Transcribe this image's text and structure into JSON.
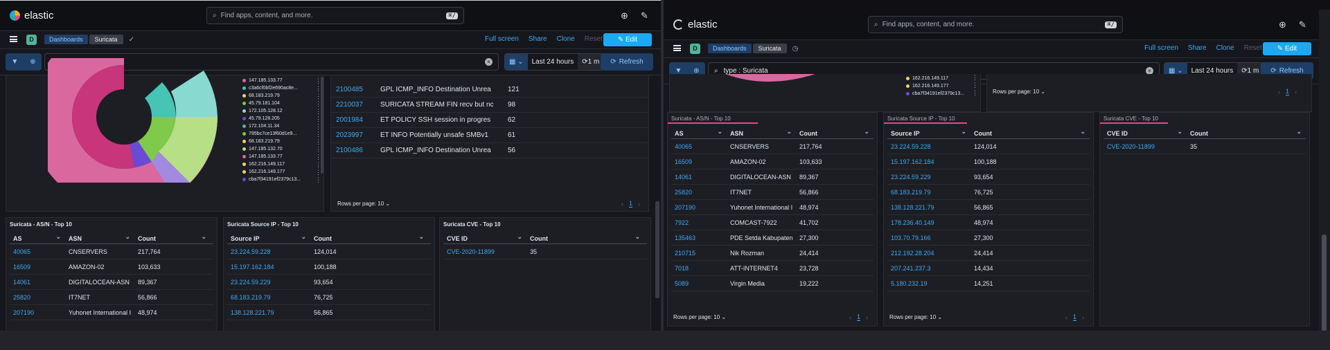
{
  "brand": {
    "name": "elastic"
  },
  "search": {
    "placeholder": "Find apps, content, and more.",
    "shortcut": "⌘/"
  },
  "breadcrumbs": {
    "dashboards": "Dashboards",
    "current": "Suricata"
  },
  "actions": {
    "full_screen": "Full screen",
    "share": "Share",
    "clone": "Clone",
    "reset": "Reset",
    "edit": "Edit"
  },
  "query": {
    "value": "type : Suricata"
  },
  "time": {
    "range": "Last 24 hours",
    "refresh_interval": "1 m",
    "refresh_label": "Refresh"
  },
  "legend_left": [
    "147.185.133.77",
    "c3a6cf0bf2e690ac8e...",
    "68.183.219.79",
    "45.79.181.104",
    "172.105.128.12",
    "45.79.128.205",
    "172.104.11.34",
    "795bc7ce13f60d1e9...",
    "68.183.219.79",
    "147.185.132.70",
    "147.185.133.77",
    "162.216.149.117",
    "162.216.149.177",
    "cba7f34191ef2379c13..."
  ],
  "legend_right": [
    "162.216.149.117",
    "162.216.149.177",
    "cba7f34191ef2379c13..."
  ],
  "signatures": [
    {
      "id": "2100485",
      "name": "GPL ICMP_INFO Destination Unrea",
      "count": "121"
    },
    {
      "id": "2210037",
      "name": "SURICATA STREAM FIN recv but nc",
      "count": "98"
    },
    {
      "id": "2001984",
      "name": "ET POLICY SSH session in progres",
      "count": "62"
    },
    {
      "id": "2023997",
      "name": "ET INFO Potentially unsafe SMBv1",
      "count": "61"
    },
    {
      "id": "2100486",
      "name": "GPL ICMP_INFO Destination Unrea",
      "count": "56"
    }
  ],
  "rows_per_page": "Rows per page: 10",
  "page_num": "1",
  "asn_panel": {
    "title": "Suricata - AS/N - Top 10",
    "headers": [
      "AS",
      "ASN",
      "Count"
    ],
    "rows": [
      [
        "40065",
        "CNSERVERS",
        "217,764"
      ],
      [
        "16509",
        "AMAZON-02",
        "103,633"
      ],
      [
        "14061",
        "DIGITALOCEAN-ASN",
        "89,367"
      ],
      [
        "25820",
        "IT7NET",
        "56,866"
      ],
      [
        "207190",
        "Yuhonet International I",
        "48,974"
      ],
      [
        "7922",
        "COMCAST-7922",
        "41,702"
      ],
      [
        "135463",
        "PDE Setda Kabupaten",
        "27,300"
      ],
      [
        "210715",
        "Nik Rozman",
        "24,414"
      ],
      [
        "7018",
        "ATT-INTERNET4",
        "23,728"
      ],
      [
        "5089",
        "Virgin Media",
        "19,222"
      ]
    ]
  },
  "srcip_panel": {
    "title": "Suricata Source IP - Top 10",
    "headers": [
      "Source IP",
      "Count"
    ],
    "rows": [
      [
        "23.224.59.228",
        "124,014"
      ],
      [
        "15.197.162.184",
        "100,188"
      ],
      [
        "23.224.59.229",
        "93,654"
      ],
      [
        "68.183.219.79",
        "76,725"
      ],
      [
        "138.128.221.79",
        "56,865"
      ],
      [
        "178.236.40.149",
        "48,974"
      ],
      [
        "103.70.79.166",
        "27,300"
      ],
      [
        "212.192.28.204",
        "24,414"
      ],
      [
        "207.241.237.3",
        "14,434"
      ],
      [
        "5.180.232.19",
        "14,251"
      ]
    ]
  },
  "cve_panel": {
    "title": "Suricata CVE - Top 10",
    "headers": [
      "CVE ID",
      "Count"
    ],
    "rows": [
      [
        "CVE-2020-11899",
        "35"
      ]
    ]
  },
  "colors": {
    "accent": "#1ba9f5",
    "link": "#3fa9f5",
    "pink": "#e7478b",
    "teal": "#54b399"
  }
}
